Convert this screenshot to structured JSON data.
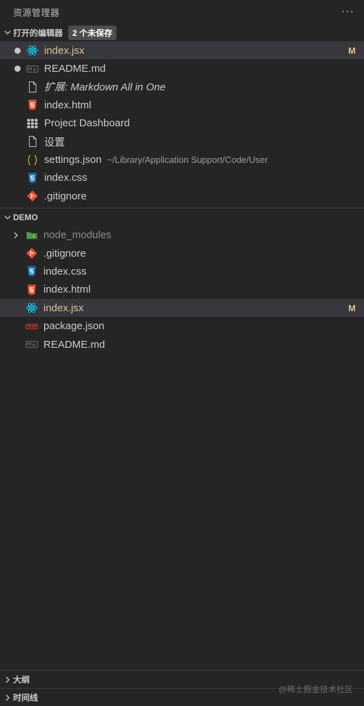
{
  "explorer": {
    "title": "资源管理器",
    "more_glyph": "···"
  },
  "open_editors": {
    "title": "打开的编辑器",
    "badge": "2 个未保存",
    "items": [
      {
        "label": "index.jsx",
        "icon": "react-icon",
        "unsaved": true,
        "status": "M",
        "active": true
      },
      {
        "label": "README.md",
        "icon": "markdown-icon",
        "unsaved": true
      },
      {
        "label": "扩展: Markdown All in One",
        "icon": "file-icon",
        "italic": true
      },
      {
        "label": "index.html",
        "icon": "html5-icon"
      },
      {
        "label": "Project Dashboard",
        "icon": "grid-icon"
      },
      {
        "label": "设置",
        "icon": "file-icon"
      },
      {
        "label": "settings.json",
        "icon": "json-braces-icon",
        "description": "~/Library/Application Support/Code/User"
      },
      {
        "label": "index.css",
        "icon": "css3-icon"
      },
      {
        "label": ".gitignore",
        "icon": "git-icon"
      }
    ]
  },
  "workspace": {
    "title": "DEMO",
    "items": [
      {
        "label": "node_modules",
        "icon": "node-folder-icon",
        "folder": true
      },
      {
        "label": ".gitignore",
        "icon": "git-icon"
      },
      {
        "label": "index.css",
        "icon": "css3-icon"
      },
      {
        "label": "index.html",
        "icon": "html5-icon"
      },
      {
        "label": "index.jsx",
        "icon": "react-icon",
        "status": "M",
        "active": true
      },
      {
        "label": "package.json",
        "icon": "npm-icon"
      },
      {
        "label": "README.md",
        "icon": "markdown-icon"
      }
    ]
  },
  "panels": {
    "outline": "大纲",
    "timeline": "时间线"
  },
  "watermark": "@稀土掘金技术社区",
  "colors": {
    "background": "#252526",
    "modified": "#e2c08d",
    "active_row": "#37373d",
    "react": "#00d8ff",
    "html": "#e44d26",
    "css": "#1572b6",
    "git": "#e84e31",
    "json": "#f1c40f",
    "npm": "#cb3837"
  }
}
